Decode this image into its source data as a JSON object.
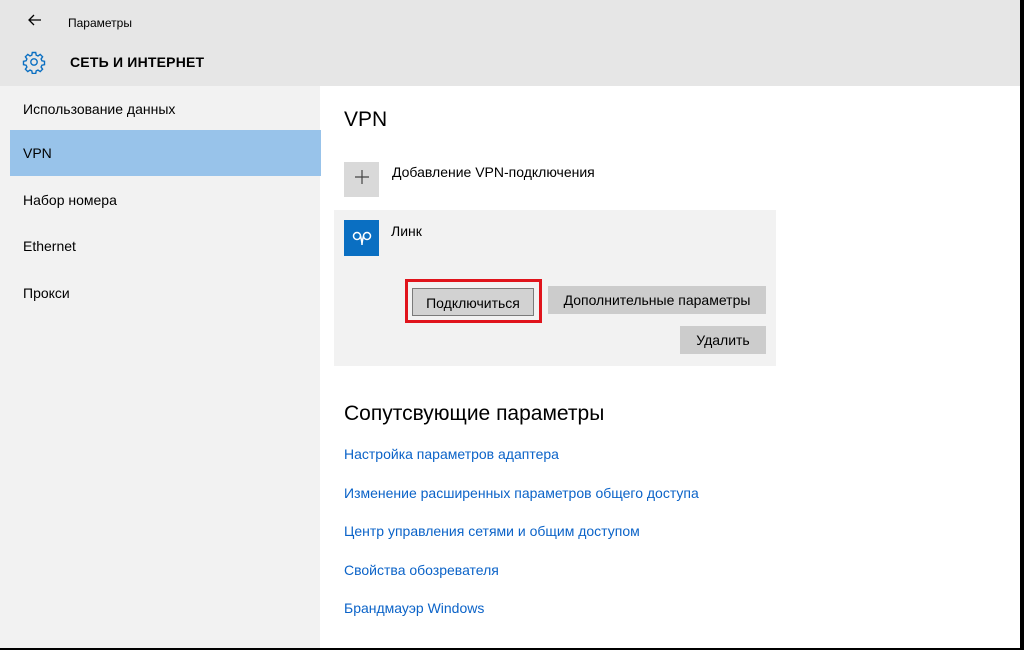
{
  "window": {
    "app_title": "Параметры",
    "section_title": "СЕТЬ И ИНТЕРНЕТ"
  },
  "icons": {
    "back": "back-arrow-icon",
    "settings": "gear-icon",
    "add": "plus-icon",
    "vpn": "vpn-link-icon"
  },
  "colors": {
    "accent": "#0a6fc2",
    "nav_active": "#98c3ea",
    "link": "#0b63c8",
    "highlight_box": "#e0141c"
  },
  "sidebar": {
    "items": [
      {
        "label": "Использование данных",
        "active": false
      },
      {
        "label": "VPN",
        "active": true
      },
      {
        "label": "Набор номера",
        "active": false
      },
      {
        "label": "Ethernet",
        "active": false
      },
      {
        "label": "Прокси",
        "active": false
      }
    ]
  },
  "main": {
    "heading": "VPN",
    "add_connection_label": "Добавление VPN-подключения",
    "connection": {
      "name": "Линк",
      "connect_button": "Подключиться",
      "advanced_button": "Дополнительные параметры",
      "delete_button": "Удалить"
    },
    "related_heading": "Сопутсвующие параметры",
    "related_links": [
      "Настройка параметров адаптера",
      "Изменение расширенных параметров общего доступа",
      "Центр управления сетями и общим доступом",
      "Свойства обозревателя",
      "Брандмауэр Windows"
    ]
  }
}
